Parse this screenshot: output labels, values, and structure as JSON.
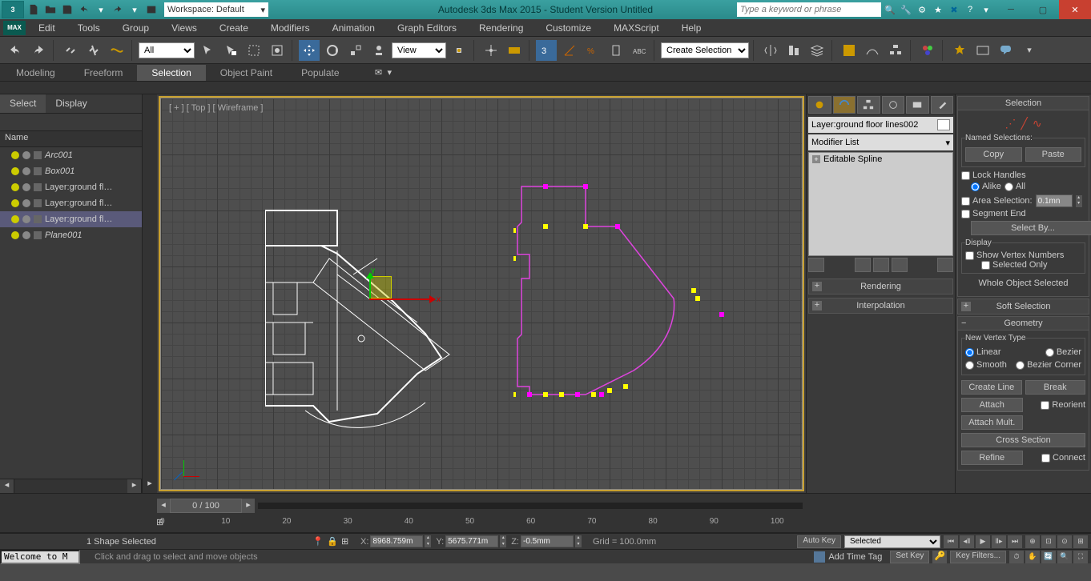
{
  "titlebar": {
    "workspace_label": "Workspace: Default",
    "title": "Autodesk 3ds Max  2015  - Student Version    Untitled",
    "search_placeholder": "Type a keyword or phrase"
  },
  "menu": [
    "Edit",
    "Tools",
    "Group",
    "Views",
    "Create",
    "Modifiers",
    "Animation",
    "Graph Editors",
    "Rendering",
    "Customize",
    "MAXScript",
    "Help"
  ],
  "ribbon": {
    "tabs": [
      "Modeling",
      "Freeform",
      "Selection",
      "Object Paint",
      "Populate"
    ],
    "active": "Selection"
  },
  "toolbar": {
    "filter_combo": "All",
    "refcoord_combo": "View",
    "named_sel_combo": "Create Selection Se"
  },
  "scene": {
    "tabs": [
      "Select",
      "Display"
    ],
    "active": "Select",
    "header": "Name",
    "items": [
      {
        "label": "Arc001",
        "type": "geom",
        "sel": false
      },
      {
        "label": "Box001",
        "type": "geom",
        "sel": false
      },
      {
        "label": "Layer:ground fl…",
        "type": "layer",
        "sel": false
      },
      {
        "label": "Layer:ground fl…",
        "type": "layer",
        "sel": false
      },
      {
        "label": "Layer:ground fl…",
        "type": "layer",
        "sel": true
      },
      {
        "label": "Plane001",
        "type": "geom",
        "sel": false
      }
    ]
  },
  "viewport": {
    "label": "[ + ] [ Top ] [ Wireframe ]"
  },
  "command": {
    "name": "Layer:ground floor lines002",
    "modlist": "Modifier List",
    "stack_item": "Editable Spline",
    "rollouts": [
      "Rendering",
      "Interpolation"
    ]
  },
  "selection_panel": {
    "title": "Selection",
    "named_label": "Named Selections:",
    "copy": "Copy",
    "paste": "Paste",
    "lock": "Lock Handles",
    "alike": "Alike",
    "all": "All",
    "area": "Area Selection:",
    "area_val": "0.1mn",
    "segend": "Segment End",
    "selectby": "Select By...",
    "display": "Display",
    "showvert": "Show Vertex Numbers",
    "selonly": "Selected Only",
    "status": "Whole Object Selected"
  },
  "soft_sel": {
    "title": "Soft Selection"
  },
  "geometry": {
    "title": "Geometry",
    "newvert": "New Vertex Type",
    "linear": "Linear",
    "bezier": "Bezier",
    "smooth": "Smooth",
    "bezcorner": "Bezier Corner",
    "createline": "Create Line",
    "break": "Break",
    "attach": "Attach",
    "attachmult": "Attach Mult.",
    "reorient": "Reorient",
    "crosssect": "Cross Section",
    "refine": "Refine",
    "connect": "Connect"
  },
  "timeline": {
    "time_display": "0 / 100",
    "ticks": [
      "0",
      "10",
      "20",
      "30",
      "40",
      "50",
      "60",
      "70",
      "80",
      "90",
      "100"
    ]
  },
  "status": {
    "autokey": "Auto Key",
    "setkey": "Set Key",
    "selected": "Selected",
    "keyfilters": "Key Filters...",
    "shape": "1 Shape Selected",
    "x": "8968.759m",
    "y": "5675.771m",
    "z": "-0.5mm",
    "grid": "Grid = 100.0mm",
    "welcome": "Welcome to M",
    "hint": "Click and drag to select and move objects",
    "addtag": "Add Time Tag"
  }
}
